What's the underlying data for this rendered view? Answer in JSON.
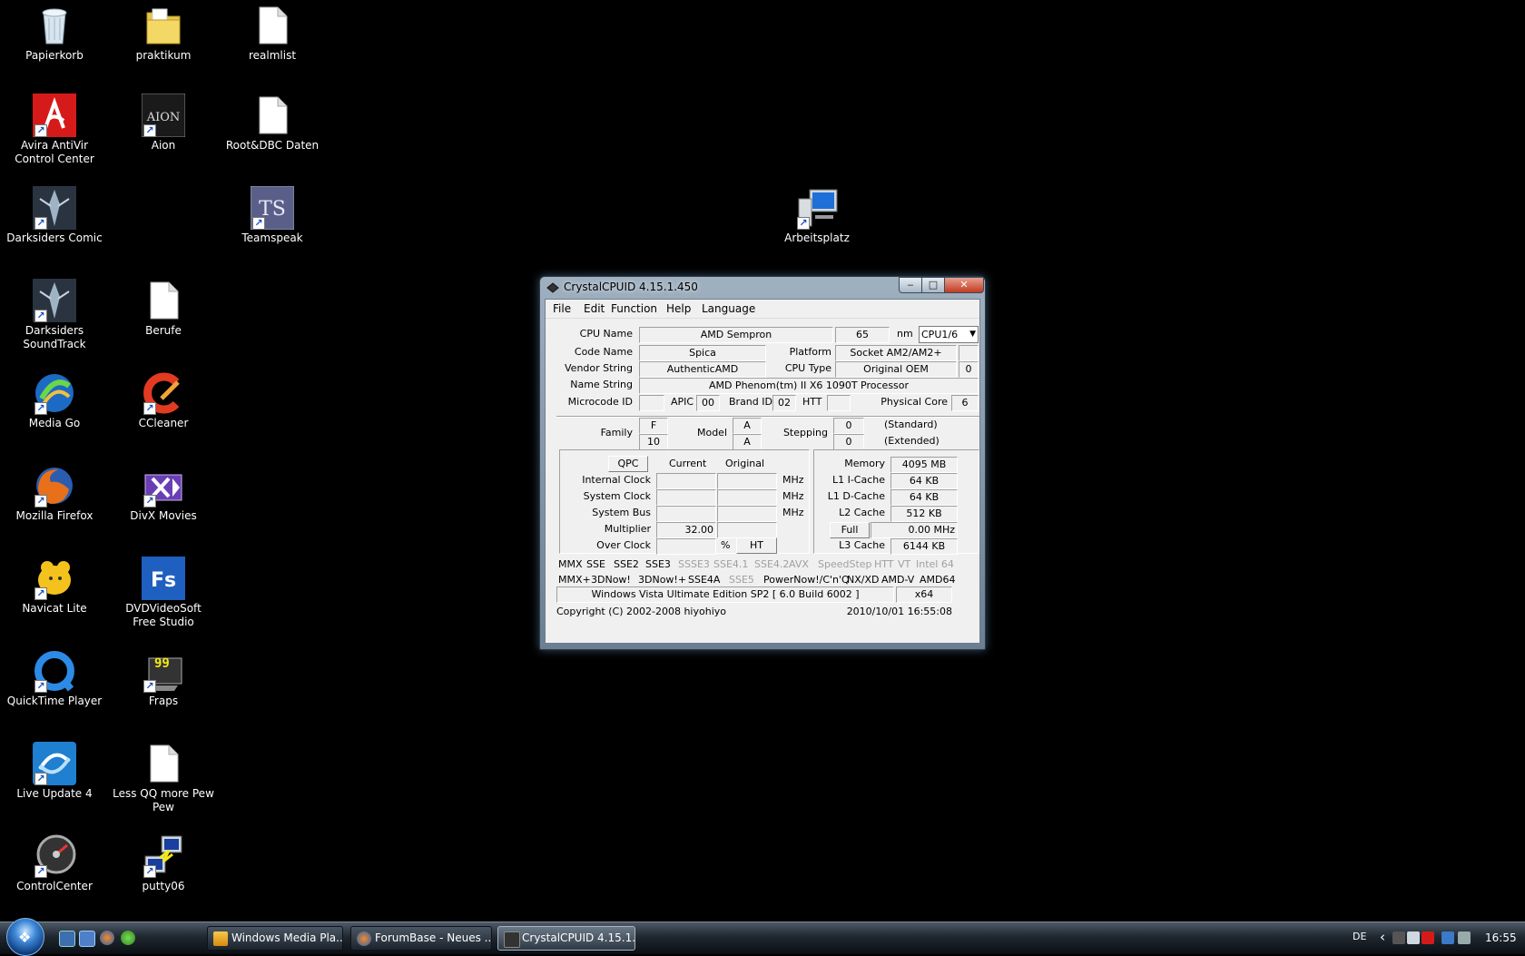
{
  "desktop": {
    "icons": [
      {
        "label": "Papierkorb",
        "icon": "recycle-bin-icon"
      },
      {
        "label": "praktikum",
        "icon": "folder-icon"
      },
      {
        "label": "realmlist",
        "icon": "text-file-icon"
      },
      {
        "label": "Avira AntiVir Control Center",
        "icon": "avira-icon"
      },
      {
        "label": "Aion",
        "icon": "aion-icon",
        "glyph": "AION"
      },
      {
        "label": "Root&DBC Daten",
        "icon": "text-file-icon"
      },
      {
        "label": "Darksiders Comic",
        "icon": "darksiders-icon"
      },
      {
        "label": "Teamspeak",
        "icon": "teamspeak-icon",
        "glyph": "TS"
      },
      {
        "label": "Arbeitsplatz",
        "icon": "computer-icon"
      },
      {
        "label": "Darksiders SoundTrack",
        "icon": "darksiders-icon"
      },
      {
        "label": "Berufe",
        "icon": "text-file-icon"
      },
      {
        "label": "Media Go",
        "icon": "media-go-icon"
      },
      {
        "label": "CCleaner",
        "icon": "ccleaner-icon"
      },
      {
        "label": "Mozilla Firefox",
        "icon": "firefox-icon"
      },
      {
        "label": "DivX Movies",
        "icon": "divx-icon"
      },
      {
        "label": "Navicat Lite",
        "icon": "navicat-icon"
      },
      {
        "label": "DVDVideoSoft Free Studio",
        "icon": "dvdvideosoft-icon",
        "glyph": "Fs"
      },
      {
        "label": "QuickTime Player",
        "icon": "quicktime-icon"
      },
      {
        "label": "Fraps",
        "icon": "fraps-icon",
        "glyph": "99"
      },
      {
        "label": "Live Update 4",
        "icon": "live-update-icon"
      },
      {
        "label": "Less QQ more Pew Pew",
        "icon": "text-file-icon"
      },
      {
        "label": "ControlCenter",
        "icon": "control-center-icon"
      },
      {
        "label": "putty06",
        "icon": "putty-icon"
      }
    ]
  },
  "window": {
    "title": "CrystalCPUID 4.15.1.450",
    "caption_minimize": "‒",
    "caption_maximize": "□",
    "caption_close": "✕",
    "menu": [
      "File",
      "Edit",
      "Function",
      "Help",
      "Language"
    ],
    "labels": {
      "cpu_name": "CPU Name",
      "nm": "nm",
      "code_name": "Code Name",
      "platform": "Platform",
      "vendor_string": "Vendor String",
      "cpu_type": "CPU Type",
      "name_string": "Name String",
      "microcode_id": "Microcode ID",
      "apic": "APIC",
      "brand_id": "Brand ID",
      "htt": "HTT",
      "physical_core": "Physical Core",
      "family": "Family",
      "model": "Model",
      "stepping": "Stepping",
      "standard": "(Standard)",
      "extended": "(Extended)",
      "qpc": "QPC",
      "current": "Current",
      "original": "Original",
      "internal_clock": "Internal Clock",
      "system_clock": "System Clock",
      "system_bus": "System Bus",
      "multiplier": "Multiplier",
      "over_clock": "Over Clock",
      "mhz": "MHz",
      "percent": "%",
      "ht": "HT",
      "memory": "Memory",
      "l1i": "L1 I-Cache",
      "l1d": "L1 D-Cache",
      "l2": "L2 Cache",
      "l3": "L3 Cache",
      "full": "Full"
    },
    "values": {
      "cpu_name": "AMD Sempron",
      "process_nm": "65",
      "cpu_select": "CPU1/6",
      "code_name": "Spica",
      "platform": "Socket AM2/AM2+",
      "platform_extra": "",
      "vendor_string": "AuthenticAMD",
      "cpu_type": "Original OEM",
      "cpu_type_num": "0",
      "name_string": "AMD Phenom(tm) II X6 1090T Processor",
      "microcode_id": "",
      "apic": "00",
      "brand_id": "02",
      "htt": "",
      "physical_core": "6",
      "family_std": "F",
      "family_ext": "10",
      "model_std": "A",
      "model_ext": "A",
      "stepping_std": "0",
      "stepping_ext": "0",
      "internal_clock_cur": "",
      "internal_clock_orig": "",
      "system_clock_cur": "",
      "system_clock_orig": "",
      "system_bus_cur": "",
      "system_bus_orig": "",
      "multiplier_cur": "32.00",
      "multiplier_orig": "",
      "over_clock": "",
      "memory": "4095 MB",
      "l1i": "64 KB",
      "l1d": "64 KB",
      "l2": "512 KB",
      "l3": "6144 KB",
      "full_mhz": "0.00 MHz"
    },
    "flags_row1": [
      {
        "name": "MMX",
        "on": true
      },
      {
        "name": "SSE",
        "on": true
      },
      {
        "name": "SSE2",
        "on": true
      },
      {
        "name": "SSE3",
        "on": true
      },
      {
        "name": "SSSE3",
        "on": false
      },
      {
        "name": "SSE4.1",
        "on": false
      },
      {
        "name": "SSE4.2",
        "on": false
      },
      {
        "name": "AVX",
        "on": false
      },
      {
        "name": "SpeedStep",
        "on": false
      },
      {
        "name": "HTT",
        "on": false
      },
      {
        "name": "VT",
        "on": false
      },
      {
        "name": "Intel 64",
        "on": false
      }
    ],
    "flags_row2": [
      {
        "name": "MMX+",
        "on": true
      },
      {
        "name": "3DNow!",
        "on": true
      },
      {
        "name": "3DNow!+",
        "on": true
      },
      {
        "name": "SSE4A",
        "on": true
      },
      {
        "name": "SSE5",
        "on": false
      },
      {
        "name": "PowerNow!/C'n'Q",
        "on": true
      },
      {
        "name": "NX/XD",
        "on": true
      },
      {
        "name": "AMD-V",
        "on": true
      },
      {
        "name": "AMD64",
        "on": true
      }
    ],
    "os_string": "Windows Vista Ultimate Edition SP2 [ 6.0 Build 6002 ]",
    "os_arch": "x64",
    "copyright": "Copyright (C) 2002-2008 hiyohiyo",
    "timestamp": "2010/10/01 16:55:08"
  },
  "taskbar": {
    "start_glyph": "❖",
    "buttons": [
      {
        "label": "Windows Media Pla...",
        "icon": "media-player-icon",
        "active": false
      },
      {
        "label": "ForumBase - Neues ...",
        "icon": "firefox-icon",
        "active": false
      },
      {
        "label": "CrystalCPUID 4.15.1....",
        "icon": "crystalcpuid-icon",
        "active": true
      }
    ],
    "tray": {
      "language": "DE",
      "chevron": "‹",
      "clock": "16:55"
    }
  },
  "colors": {
    "desktop_bg": "#000000",
    "dialog_bg": "#f0f0f0",
    "disabled_flag": "#a0a0a0"
  }
}
